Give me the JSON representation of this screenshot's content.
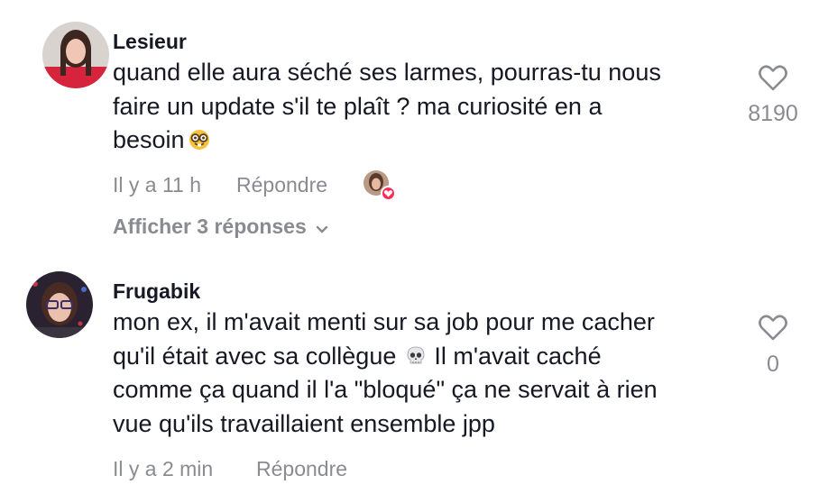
{
  "comments": [
    {
      "username": "Lesieur",
      "lines": [
        "quand elle aura séché ses larmes, pourras-tu nous",
        "faire un update s'il te plaît ? ma curiosité en a",
        "besoin"
      ],
      "emoji": "nerd-face-emoji",
      "time": "Il y a 11 h",
      "reply_label": "Répondre",
      "like_count": "8190",
      "liked_by_creator": true,
      "replies_label": "Afficher 3 réponses"
    },
    {
      "username": "Frugabik",
      "lines": [
        "mon ex, il m'avait menti sur sa job pour me cacher",
        "qu'il était avec sa collègue",
        "comme ça quand il l'a \"bloqué\" ça ne servait à rien",
        "vue qu'ils travaillaient ensemble jpp"
      ],
      "line2_suffix": "Il m'avait caché",
      "emoji": "skull-emoji",
      "time": "Il y a 2 min",
      "reply_label": "Répondre",
      "like_count": "0"
    }
  ],
  "colors": {
    "text": "#161823",
    "muted": "#8a8b91",
    "heart_badge": "#fe2c55"
  }
}
